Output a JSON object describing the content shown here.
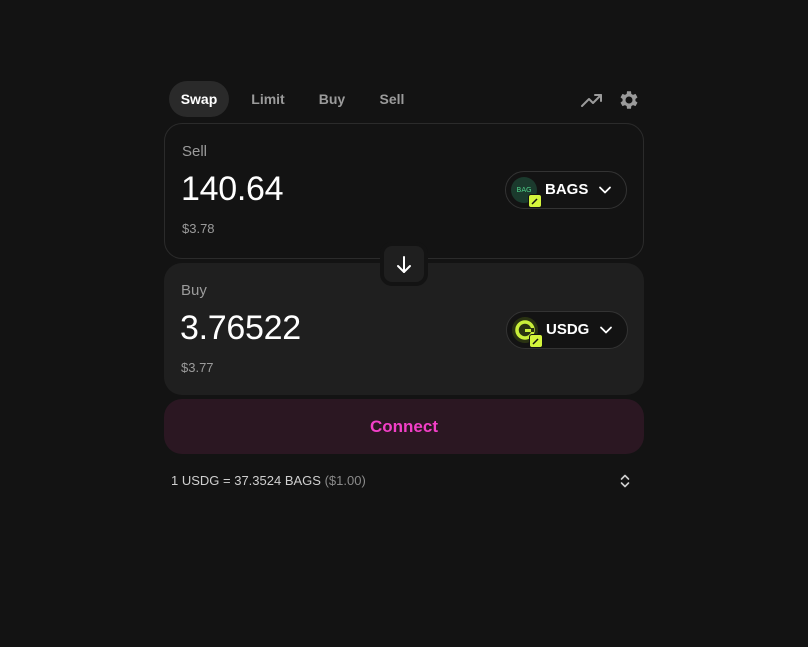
{
  "tabs": [
    {
      "label": "Swap",
      "active": true
    },
    {
      "label": "Limit",
      "active": false
    },
    {
      "label": "Buy",
      "active": false
    },
    {
      "label": "Sell",
      "active": false
    }
  ],
  "toolbar": {
    "chart_icon": "trending-up-icon",
    "settings_icon": "gear-icon"
  },
  "sell": {
    "label": "Sell",
    "amount": "140.64",
    "usd_value": "$3.78",
    "token": {
      "symbol": "BAGS",
      "logo_text": "BAG"
    }
  },
  "buy": {
    "label": "Buy",
    "amount": "3.76522",
    "usd_value": "$3.77",
    "token": {
      "symbol": "USDG"
    }
  },
  "switch_icon": "arrow-down-icon",
  "connect": {
    "label": "Connect"
  },
  "rate": {
    "text": "1 USDG = 37.3524 BAGS",
    "usd": "($1.00)"
  },
  "colors": {
    "background": "#131313",
    "panel": "#1f1f1f",
    "accent_pink": "#fc37d7",
    "connect_bg": "#2b1722",
    "chain_badge": "#d4f53c"
  }
}
